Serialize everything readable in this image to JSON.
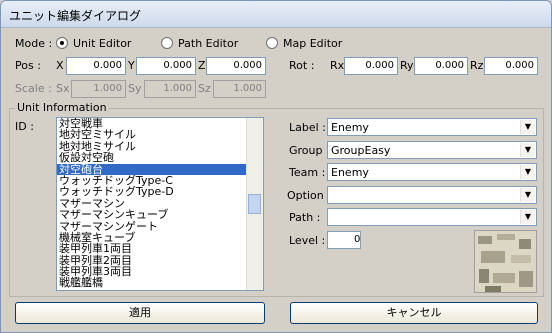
{
  "window": {
    "title": "ユニット編集ダイアログ"
  },
  "mode": {
    "label": "Mode :",
    "options": [
      {
        "label": "Unit Editor",
        "selected": true
      },
      {
        "label": "Path Editor",
        "selected": false
      },
      {
        "label": "Map Editor",
        "selected": false
      }
    ]
  },
  "pos": {
    "label": "Pos :",
    "x_label": "X",
    "y_label": "Y",
    "z_label": "Z",
    "x": "0.000",
    "y": "0.000",
    "z": "0.000"
  },
  "rot": {
    "label": "Rot :",
    "x_label": "Rx",
    "y_label": "Ry",
    "z_label": "Rz",
    "x": "0.000",
    "y": "0.000",
    "z": "0.000"
  },
  "scale": {
    "label": "Scale :",
    "x_label": "Sx",
    "y_label": "Sy",
    "z_label": "Sz",
    "x": "1.000",
    "y": "1.000",
    "z": "1.000"
  },
  "unit_info": {
    "group_title": "Unit Information",
    "id_label": "ID :",
    "list_items": [
      "対空戦車",
      "地対空ミサイル",
      "地対地ミサイル",
      "仮設対空砲",
      "対空砲台",
      "ウォッチドッグType-C",
      "ウォッチドッグType-D",
      "マザーマシン",
      "マザーマシンキューブ",
      "マザーマシンゲート",
      "機械室キューブ",
      "装甲列車1両目",
      "装甲列車2両目",
      "装甲列車3両目",
      "戦艦艦橋"
    ],
    "selected_index": 4,
    "label_field": {
      "label": "Label :",
      "value": "Enemy"
    },
    "group_field": {
      "label": "Group :",
      "value": "GroupEasy"
    },
    "team_field": {
      "label": "Team :",
      "value": "Enemy"
    },
    "option_field": {
      "label": "Option :",
      "value": ""
    },
    "path_field": {
      "label": "Path :",
      "value": ""
    },
    "level_field": {
      "label": "Level :",
      "value": "0"
    }
  },
  "buttons": {
    "apply": "適用",
    "cancel": "キャンセル"
  },
  "icons": {
    "combo_arrow": "chevron-down-icon",
    "radio": "radio-icon"
  }
}
